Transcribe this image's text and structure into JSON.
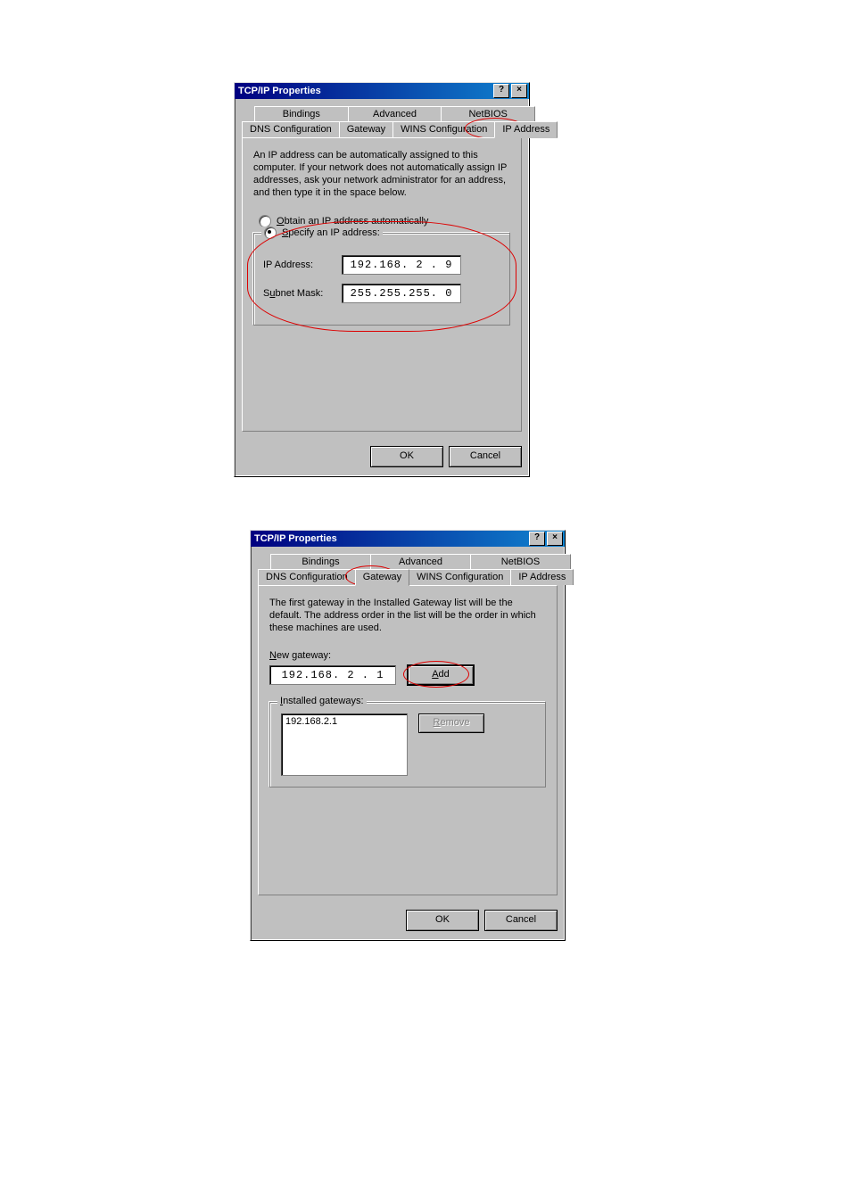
{
  "dialog1": {
    "title": "TCP/IP Properties",
    "sys_help": "?",
    "sys_close": "×",
    "tabs_row1": [
      "Bindings",
      "Advanced",
      "NetBIOS"
    ],
    "tabs_row2": [
      "DNS Configuration",
      "Gateway",
      "WINS Configuration",
      "IP Address"
    ],
    "active_tab": "IP Address",
    "description": "An IP address can be automatically assigned to this computer. If your network does not automatically assign IP addresses, ask your network administrator for an address, and then type it in the space below.",
    "radio_obtain": "Obtain an IP address automatically",
    "radio_specify": "Specify an IP address:",
    "radio_selected": "specify",
    "ip_label": "IP Address:",
    "ip_value": "192.168. 2 .  9",
    "mask_label": "Subnet Mask:",
    "mask_value": "255.255.255. 0",
    "ok": "OK",
    "cancel": "Cancel"
  },
  "dialog2": {
    "title": "TCP/IP Properties",
    "sys_help": "?",
    "sys_close": "×",
    "tabs_row1": [
      "Bindings",
      "Advanced",
      "NetBIOS"
    ],
    "tabs_row2": [
      "DNS Configuration",
      "Gateway",
      "WINS Configuration",
      "IP Address"
    ],
    "active_tab": "Gateway",
    "description": "The first gateway in the Installed Gateway list will be the default. The address order in the list will be the order in which these machines are used.",
    "new_gateway_label": "New gateway:",
    "new_gateway_value": "192.168. 2 . 1",
    "add_btn": "Add",
    "installed_label": "Installed gateways:",
    "installed_items": [
      "192.168.2.1"
    ],
    "remove_btn": "Remove",
    "ok": "OK",
    "cancel": "Cancel"
  }
}
